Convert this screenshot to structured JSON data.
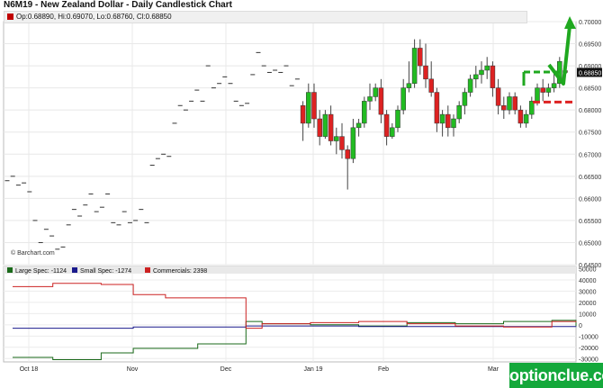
{
  "title": "N6M19 - New Zealand Dollar - Daily Candlestick Chart",
  "ohlc_text": "Op:0.68890, Hi:0.69070, Lo:0.68760, Cl:0.68850",
  "last_price_label": "0.68850",
  "credit": "© Barchart.com",
  "watermark": "optionclue.com",
  "colors": {
    "up": "#22bb22",
    "down": "#dd2222",
    "large_spec": "#1a6a1a",
    "small_spec": "#1a1a8c",
    "commercials": "#cc2222",
    "annotation": "#1fa81f"
  },
  "chart_data": [
    {
      "type": "candlestick",
      "title": "N6M19 - New Zealand Dollar - Daily Candlestick Chart",
      "y_ticks": [
        "0.70000",
        "0.69500",
        "0.69000",
        "0.68850",
        "0.68500",
        "0.68000",
        "0.67500",
        "0.67000",
        "0.66500",
        "0.66000",
        "0.65500",
        "0.65000",
        "0.64500"
      ],
      "x_ticks": [
        "Oct 18",
        "Nov",
        "Dec",
        "Jan 19",
        "Feb",
        "Mar"
      ],
      "ylim": [
        0.645,
        0.7
      ],
      "grid": true,
      "ohlc": [
        [
          0.664,
          0.6645,
          0.6635,
          0.664
        ],
        [
          0.665,
          0.6655,
          0.6645,
          0.665
        ],
        [
          0.663,
          0.6635,
          0.6625,
          0.663
        ],
        [
          0.6635,
          0.664,
          0.663,
          0.6635
        ],
        [
          0.6615,
          0.662,
          0.661,
          0.6615
        ],
        [
          0.655,
          0.6555,
          0.6545,
          0.655
        ],
        [
          0.65,
          0.6505,
          0.6495,
          0.65
        ],
        [
          0.653,
          0.6535,
          0.6525,
          0.653
        ],
        [
          0.6515,
          0.652,
          0.651,
          0.6515
        ],
        [
          0.6485,
          0.649,
          0.648,
          0.6485
        ],
        [
          0.649,
          0.6495,
          0.6485,
          0.649
        ],
        [
          0.654,
          0.6545,
          0.6535,
          0.654
        ],
        [
          0.6575,
          0.658,
          0.657,
          0.6575
        ],
        [
          0.656,
          0.6565,
          0.6555,
          0.656
        ],
        [
          0.6585,
          0.659,
          0.658,
          0.6585
        ],
        [
          0.661,
          0.6615,
          0.6605,
          0.661
        ],
        [
          0.657,
          0.6575,
          0.6565,
          0.657
        ],
        [
          0.658,
          0.6585,
          0.6575,
          0.658
        ],
        [
          0.661,
          0.6615,
          0.6605,
          0.661
        ],
        [
          0.6545,
          0.655,
          0.654,
          0.6545
        ],
        [
          0.654,
          0.6545,
          0.6535,
          0.654
        ],
        [
          0.657,
          0.6575,
          0.6565,
          0.657
        ],
        [
          0.6545,
          0.655,
          0.654,
          0.6545
        ],
        [
          0.655,
          0.6555,
          0.6545,
          0.655
        ],
        [
          0.6575,
          0.658,
          0.657,
          0.6575
        ],
        [
          0.6545,
          0.655,
          0.654,
          0.6545
        ],
        [
          0.6675,
          0.668,
          0.667,
          0.6675
        ],
        [
          0.669,
          0.6695,
          0.6685,
          0.669
        ],
        [
          0.67,
          0.6705,
          0.6695,
          0.67
        ],
        [
          0.6695,
          0.67,
          0.669,
          0.6695
        ],
        [
          0.677,
          0.6775,
          0.6765,
          0.677
        ],
        [
          0.681,
          0.6815,
          0.6805,
          0.681
        ],
        [
          0.68,
          0.6805,
          0.6795,
          0.68
        ],
        [
          0.682,
          0.6825,
          0.6815,
          0.682
        ],
        [
          0.6845,
          0.685,
          0.684,
          0.6845
        ],
        [
          0.682,
          0.6825,
          0.6815,
          0.682
        ],
        [
          0.69,
          0.6905,
          0.6895,
          0.69
        ],
        [
          0.685,
          0.6855,
          0.6845,
          0.685
        ],
        [
          0.686,
          0.6865,
          0.6855,
          0.686
        ],
        [
          0.6875,
          0.688,
          0.687,
          0.6875
        ],
        [
          0.686,
          0.6865,
          0.6855,
          0.686
        ],
        [
          0.682,
          0.6825,
          0.6815,
          0.682
        ],
        [
          0.681,
          0.6815,
          0.6805,
          0.681
        ],
        [
          0.6815,
          0.682,
          0.681,
          0.6815
        ],
        [
          0.688,
          0.6885,
          0.6875,
          0.688
        ],
        [
          0.693,
          0.6935,
          0.6925,
          0.693
        ],
        [
          0.69,
          0.6905,
          0.6895,
          0.69
        ],
        [
          0.6885,
          0.689,
          0.688,
          0.6885
        ],
        [
          0.689,
          0.6895,
          0.6885,
          0.689
        ],
        [
          0.6885,
          0.689,
          0.688,
          0.6885
        ],
        [
          0.69,
          0.6905,
          0.6895,
          0.69
        ],
        [
          0.6855,
          0.686,
          0.685,
          0.6855
        ],
        [
          0.687,
          0.6875,
          0.6865,
          0.687
        ],
        [
          0.681,
          0.682,
          0.673,
          0.677
        ],
        [
          0.677,
          0.686,
          0.676,
          0.684
        ],
        [
          0.684,
          0.686,
          0.676,
          0.678
        ],
        [
          0.678,
          0.68,
          0.672,
          0.674
        ],
        [
          0.674,
          0.68,
          0.6735,
          0.679
        ],
        [
          0.679,
          0.681,
          0.672,
          0.673
        ],
        [
          0.673,
          0.676,
          0.67,
          0.674
        ],
        [
          0.674,
          0.677,
          0.669,
          0.671
        ],
        [
          0.671,
          0.672,
          0.662,
          0.669
        ],
        [
          0.669,
          0.678,
          0.668,
          0.676
        ],
        [
          0.676,
          0.678,
          0.674,
          0.677
        ],
        [
          0.677,
          0.683,
          0.676,
          0.682
        ],
        [
          0.682,
          0.686,
          0.68,
          0.683
        ],
        [
          0.683,
          0.686,
          0.682,
          0.685
        ],
        [
          0.685,
          0.687,
          0.677,
          0.679
        ],
        [
          0.679,
          0.68,
          0.672,
          0.674
        ],
        [
          0.674,
          0.677,
          0.6735,
          0.676
        ],
        [
          0.676,
          0.681,
          0.675,
          0.68
        ],
        [
          0.68,
          0.687,
          0.679,
          0.685
        ],
        [
          0.685,
          0.691,
          0.684,
          0.686
        ],
        [
          0.686,
          0.696,
          0.685,
          0.694
        ],
        [
          0.694,
          0.696,
          0.688,
          0.69
        ],
        [
          0.69,
          0.695,
          0.685,
          0.687
        ],
        [
          0.687,
          0.691,
          0.683,
          0.684
        ],
        [
          0.684,
          0.685,
          0.675,
          0.677
        ],
        [
          0.677,
          0.68,
          0.674,
          0.679
        ],
        [
          0.679,
          0.681,
          0.674,
          0.676
        ],
        [
          0.676,
          0.679,
          0.674,
          0.678
        ],
        [
          0.678,
          0.682,
          0.677,
          0.681
        ],
        [
          0.681,
          0.685,
          0.679,
          0.684
        ],
        [
          0.684,
          0.688,
          0.683,
          0.687
        ],
        [
          0.687,
          0.69,
          0.685,
          0.688
        ],
        [
          0.688,
          0.691,
          0.686,
          0.689
        ],
        [
          0.689,
          0.692,
          0.687,
          0.69
        ],
        [
          0.69,
          0.691,
          0.683,
          0.685
        ],
        [
          0.685,
          0.687,
          0.679,
          0.681
        ],
        [
          0.681,
          0.683,
          0.678,
          0.68
        ],
        [
          0.68,
          0.684,
          0.679,
          0.683
        ],
        [
          0.683,
          0.684,
          0.679,
          0.68
        ],
        [
          0.68,
          0.681,
          0.676,
          0.677
        ],
        [
          0.677,
          0.68,
          0.676,
          0.679
        ],
        [
          0.679,
          0.683,
          0.678,
          0.682
        ],
        [
          0.682,
          0.686,
          0.681,
          0.685
        ],
        [
          0.685,
          0.687,
          0.682,
          0.684
        ],
        [
          0.684,
          0.686,
          0.683,
          0.685
        ],
        [
          0.685,
          0.689,
          0.684,
          0.686
        ],
        [
          0.686,
          0.692,
          0.685,
          0.691
        ],
        [
          0.6889,
          0.6907,
          0.6876,
          0.6885
        ]
      ],
      "series": [
        {
          "name": "",
          "color": "#22bb22"
        }
      ]
    },
    {
      "type": "line",
      "y_ticks": [
        "50000",
        "40000",
        "30000",
        "20000",
        "10000",
        "0",
        "-10000",
        "-20000",
        "-30000"
      ],
      "ylim": [
        -33000,
        52000
      ],
      "legend": [
        "Large Spec: -1124",
        "Small Spec: -1274",
        "Commercials: 2398"
      ],
      "series": [
        {
          "name": "Large Spec: -1124",
          "color": "#1a6a1a",
          "values": [
            -29000,
            -29000,
            -29000,
            -29000,
            -29000,
            -31000,
            -31000,
            -31000,
            -31000,
            -31000,
            -31000,
            -25000,
            -25000,
            -25000,
            -25000,
            -21000,
            -21000,
            -21000,
            -21000,
            -21000,
            -21000,
            -21000,
            -21000,
            -17000,
            -17000,
            -17000,
            -17000,
            -17000,
            -17000,
            3000,
            3000,
            1000,
            1000,
            1000,
            1000,
            1000,
            1000,
            0,
            0,
            0,
            0,
            0,
            0,
            -1000,
            -1000,
            -1000,
            -1000,
            -1000,
            -1000,
            2000,
            2000,
            2000,
            2000,
            2000,
            2000,
            1000,
            1000,
            1000,
            1000,
            1000,
            1000,
            3000,
            3000,
            3000,
            3000,
            3000,
            3000,
            4000,
            4000,
            4000,
            -1124
          ]
        },
        {
          "name": "Small Spec: -1274",
          "color": "#1a1a8c",
          "values": [
            -3000,
            -3000,
            -3000,
            -3000,
            -3000,
            -3000,
            -3000,
            -3000,
            -3000,
            -3000,
            -3000,
            -3000,
            -3000,
            -3000,
            -3000,
            -2000,
            -2000,
            -2000,
            -2000,
            -2000,
            -2000,
            -2000,
            -2000,
            -2000,
            -2000,
            -2000,
            -2000,
            -2000,
            -2000,
            -1000,
            -1000,
            -1000,
            -1000,
            -1000,
            -1000,
            -1000,
            -1000,
            -1000,
            -1000,
            -1000,
            -1000,
            -1000,
            -1000,
            -1500,
            -1500,
            -1500,
            -1500,
            -1500,
            -1500,
            -1500,
            -1500,
            -1500,
            -1500,
            -1500,
            -1500,
            -1500,
            -1500,
            -1500,
            -1500,
            -1500,
            -1500,
            -1500,
            -1500,
            -1500,
            -1500,
            -1500,
            -1500,
            -1500,
            -1500,
            -1500,
            -1274
          ]
        },
        {
          "name": "Commercials: 2398",
          "color": "#cc2222",
          "values": [
            34000,
            34000,
            34000,
            34000,
            34000,
            37000,
            37000,
            37000,
            37000,
            37000,
            37000,
            36000,
            36000,
            36000,
            36000,
            27000,
            27000,
            27000,
            27000,
            24000,
            24000,
            24000,
            24000,
            24000,
            24000,
            24000,
            24000,
            24000,
            24000,
            -3000,
            -3000,
            1000,
            1000,
            1000,
            1000,
            1000,
            1000,
            2000,
            2000,
            2000,
            2000,
            2000,
            2000,
            3000,
            3000,
            3000,
            3000,
            3000,
            3000,
            1000,
            1000,
            1000,
            1000,
            1000,
            1000,
            -1000,
            -1000,
            -1000,
            -1000,
            -1000,
            -1000,
            -2000,
            -2000,
            -2000,
            -2000,
            -2000,
            -2000,
            3000,
            3000,
            3000,
            2398
          ]
        }
      ]
    }
  ]
}
